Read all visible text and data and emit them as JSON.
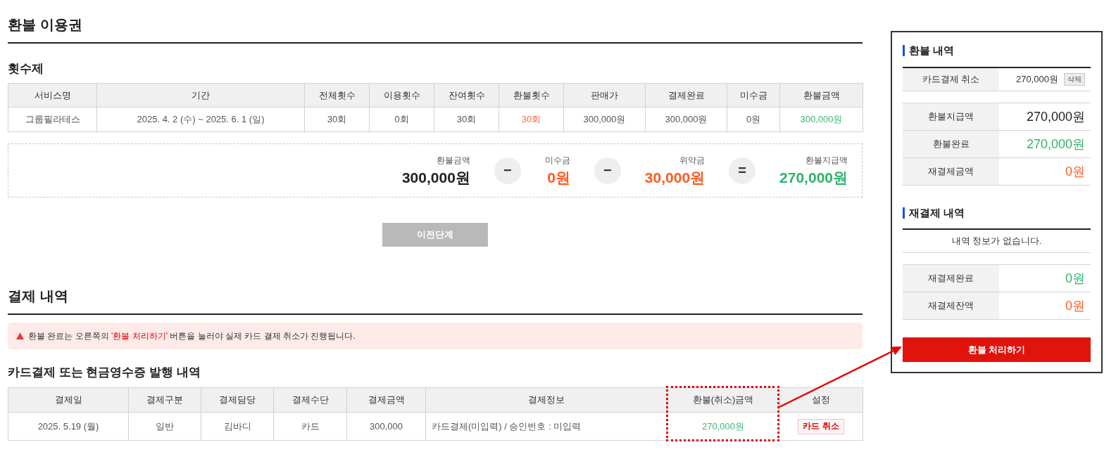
{
  "page_title": "환불 이용권",
  "ticket_section": {
    "title": "횟수제",
    "columns": [
      "서비스명",
      "기간",
      "전체횟수",
      "이용횟수",
      "잔여횟수",
      "환불횟수",
      "판매가",
      "결제완료",
      "미수금",
      "환불금액"
    ],
    "rows": [
      {
        "cells": [
          {
            "text": "그룹필라테스"
          },
          {
            "text": "2025. 4. 2 (수) ~ 2025. 6. 1 (일)"
          },
          {
            "text": "30회"
          },
          {
            "text": "0회"
          },
          {
            "text": "30회"
          },
          {
            "text": "30회",
            "color": "#ff6a3d"
          },
          {
            "text": "300,000원"
          },
          {
            "text": "300,000원"
          },
          {
            "text": "0원"
          },
          {
            "text": "300,000원",
            "color": "#3bb878"
          }
        ]
      }
    ]
  },
  "calculation": [
    {
      "kind": "term",
      "label": "환불금액",
      "amount": "300,000원",
      "color": "#222222"
    },
    {
      "kind": "operator",
      "symbol": "−"
    },
    {
      "kind": "term",
      "label": "미수금",
      "amount": "0원",
      "color": "#ff5a1f"
    },
    {
      "kind": "operator",
      "symbol": "−"
    },
    {
      "kind": "term",
      "label": "위약금",
      "amount": "30,000원",
      "color": "#ff5a1f"
    },
    {
      "kind": "operator",
      "symbol": "="
    },
    {
      "kind": "term",
      "label": "환불지급액",
      "amount": "270,000원",
      "color": "#2fb36b"
    }
  ],
  "previous_button": "이전단계",
  "payment_section": {
    "title": "결제 내역",
    "notice": {
      "before": "환불 완료는 오른쪽의 ",
      "highlight": "'환불 처리하기'",
      "after": " 버튼을 눌러야 실제 카드 결제 취소가 진행됩니다."
    },
    "subtitle": "카드결제 또는 현금영수증 발행 내역",
    "columns": [
      {
        "label": "결제일",
        "highlighted": false
      },
      {
        "label": "결제구분",
        "highlighted": false
      },
      {
        "label": "결제담당",
        "highlighted": false
      },
      {
        "label": "결제수단",
        "highlighted": false
      },
      {
        "label": "결제금액",
        "highlighted": false
      },
      {
        "label": "결제정보",
        "highlighted": false
      },
      {
        "label": "환불(취소)금액",
        "highlighted": true
      },
      {
        "label": "설정",
        "highlighted": false
      }
    ],
    "rows": [
      {
        "cells": [
          {
            "text": "2025. 5.19 (월)"
          },
          {
            "text": "일반"
          },
          {
            "text": "김바디"
          },
          {
            "text": "카드"
          },
          {
            "text": "300,000"
          },
          {
            "text": "카드결제(미입력) / 승인번호 : 미입력"
          },
          {
            "text": "270,000원",
            "color": "#3bb878"
          }
        ],
        "action_button": "카드 취소"
      }
    ]
  },
  "refund_panel": {
    "title": "환불 내역",
    "entries": [
      {
        "label": "카드결제 취소",
        "amount": "270,000원",
        "delete_button": "삭제"
      }
    ],
    "totals": [
      {
        "label": "환불지급액",
        "value": "270,000원",
        "color": "#222222"
      },
      {
        "label": "환불완료",
        "value": "270,000원",
        "color": "#2fb36b"
      },
      {
        "label": "재결제금액",
        "value": "0원",
        "color": "#ff5a1f"
      }
    ]
  },
  "repayment_panel": {
    "title": "재결제 내역",
    "empty_message": "내역 정보가 없습니다.",
    "totals": [
      {
        "label": "재결제완료",
        "value": "0원",
        "color": "#2fb36b"
      },
      {
        "label": "재결제잔액",
        "value": "0원",
        "color": "#ff5a1f"
      }
    ]
  },
  "process_button": "환불 처리하기"
}
